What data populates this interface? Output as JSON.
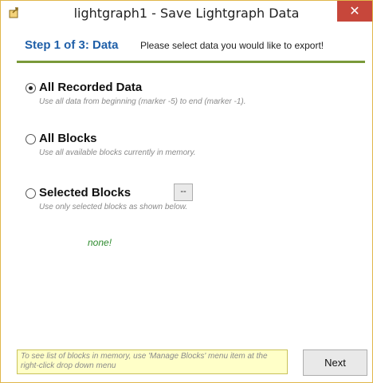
{
  "window": {
    "title": "lightgraph1 - Save Lightgraph Data",
    "close_glyph": "✕",
    "app_icon": "export-icon"
  },
  "header": {
    "step_title": "Step 1 of 3: Data",
    "step_description": "Please select data you would like to export!",
    "rule_color": "#7a9a3a"
  },
  "options": [
    {
      "label": "All Recorded Data",
      "description": "Use all data from beginning (marker -5) to end (marker -1).",
      "selected": true
    },
    {
      "label": "All Blocks",
      "description": "Use all available blocks currently in memory.",
      "selected": false
    },
    {
      "label": "Selected Blocks",
      "description": "Use only selected blocks as shown below.",
      "selected": false,
      "button_label": "--"
    }
  ],
  "selection_status": "none!",
  "hint": "To see list of blocks in memory, use 'Manage Blocks' menu item at the right-click drop down menu",
  "next_label": "Next",
  "colors": {
    "accent": "#1f5fa8",
    "close": "#c7473b",
    "status_green": "#2e8b2e",
    "hint_bg": "#ffffc8"
  }
}
